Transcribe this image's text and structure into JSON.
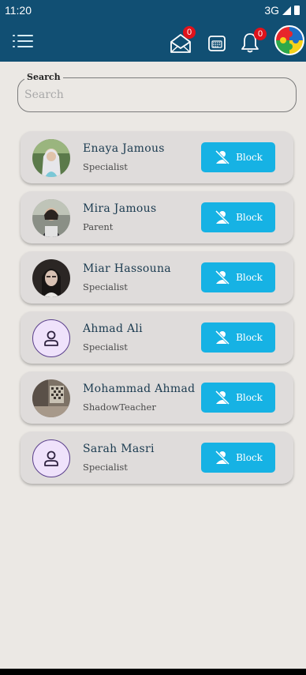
{
  "status_bar": {
    "time": "11:20",
    "network": "3G"
  },
  "app_bar": {
    "messages_badge": "0",
    "notifications_badge": "0"
  },
  "search": {
    "label": "Search",
    "placeholder": "Search",
    "value": ""
  },
  "block_label": "Block",
  "users": [
    {
      "name": "Enaya Jamous",
      "role": "Specialist",
      "avatar": "photo"
    },
    {
      "name": "Mira Jamous",
      "role": "Parent",
      "avatar": "photo"
    },
    {
      "name": "Miar Hassouna",
      "role": "Specialist",
      "avatar": "photo"
    },
    {
      "name": "Ahmad Ali",
      "role": "Specialist",
      "avatar": "placeholder"
    },
    {
      "name": "Mohammad Ahmad",
      "role": "ShadowTeacher",
      "avatar": "photo"
    },
    {
      "name": "Sarah Masri",
      "role": "Specialist",
      "avatar": "placeholder"
    }
  ],
  "colors": {
    "primary": "#114f73",
    "block_button": "#16b2e4",
    "badge": "#e0121b",
    "background": "#ebe8e4",
    "card": "#dfdcdb"
  }
}
